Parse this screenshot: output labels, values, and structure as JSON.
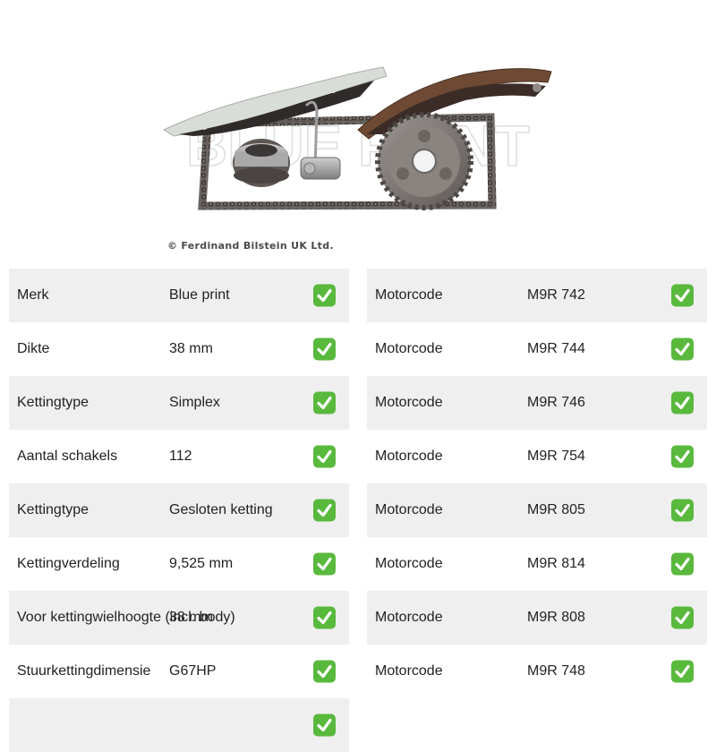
{
  "image": {
    "watermark_text": "BLUE PRINT",
    "copyright": "© Ferdinand Bilstein UK Ltd."
  },
  "specs_left": [
    {
      "label": "Merk",
      "value": "Blue print",
      "checked": true
    },
    {
      "label": "Dikte",
      "value": "38 mm",
      "checked": true
    },
    {
      "label": "Kettingtype",
      "value": "Simplex",
      "checked": true
    },
    {
      "label": "Aantal schakels",
      "value": "112",
      "checked": true
    },
    {
      "label": "Kettingtype",
      "value": "Gesloten ketting",
      "checked": true
    },
    {
      "label": "Kettingverdeling",
      "value": "9,525 mm",
      "checked": true
    },
    {
      "label": "Voor kettingwielhoogte (incl. body)",
      "value": "38 mm",
      "checked": true
    },
    {
      "label": "Stuurkettingdimensie",
      "value": "G67HP",
      "checked": true
    },
    {
      "label": "",
      "value": "",
      "checked": true
    }
  ],
  "specs_right": [
    {
      "label": "Motorcode",
      "value": "M9R 742",
      "checked": true
    },
    {
      "label": "Motorcode",
      "value": "M9R 744",
      "checked": true
    },
    {
      "label": "Motorcode",
      "value": "M9R 746",
      "checked": true
    },
    {
      "label": "Motorcode",
      "value": "M9R 754",
      "checked": true
    },
    {
      "label": "Motorcode",
      "value": "M9R 805",
      "checked": true
    },
    {
      "label": "Motorcode",
      "value": "M9R 814",
      "checked": true
    },
    {
      "label": "Motorcode",
      "value": "M9R 808",
      "checked": true
    },
    {
      "label": "Motorcode",
      "value": "M9R 748",
      "checked": true
    }
  ],
  "colors": {
    "row_shaded": "#efefef",
    "check": "#59b93d",
    "text": "#222222"
  },
  "icons": {
    "check": "white-heavy-check-mark-icon"
  }
}
